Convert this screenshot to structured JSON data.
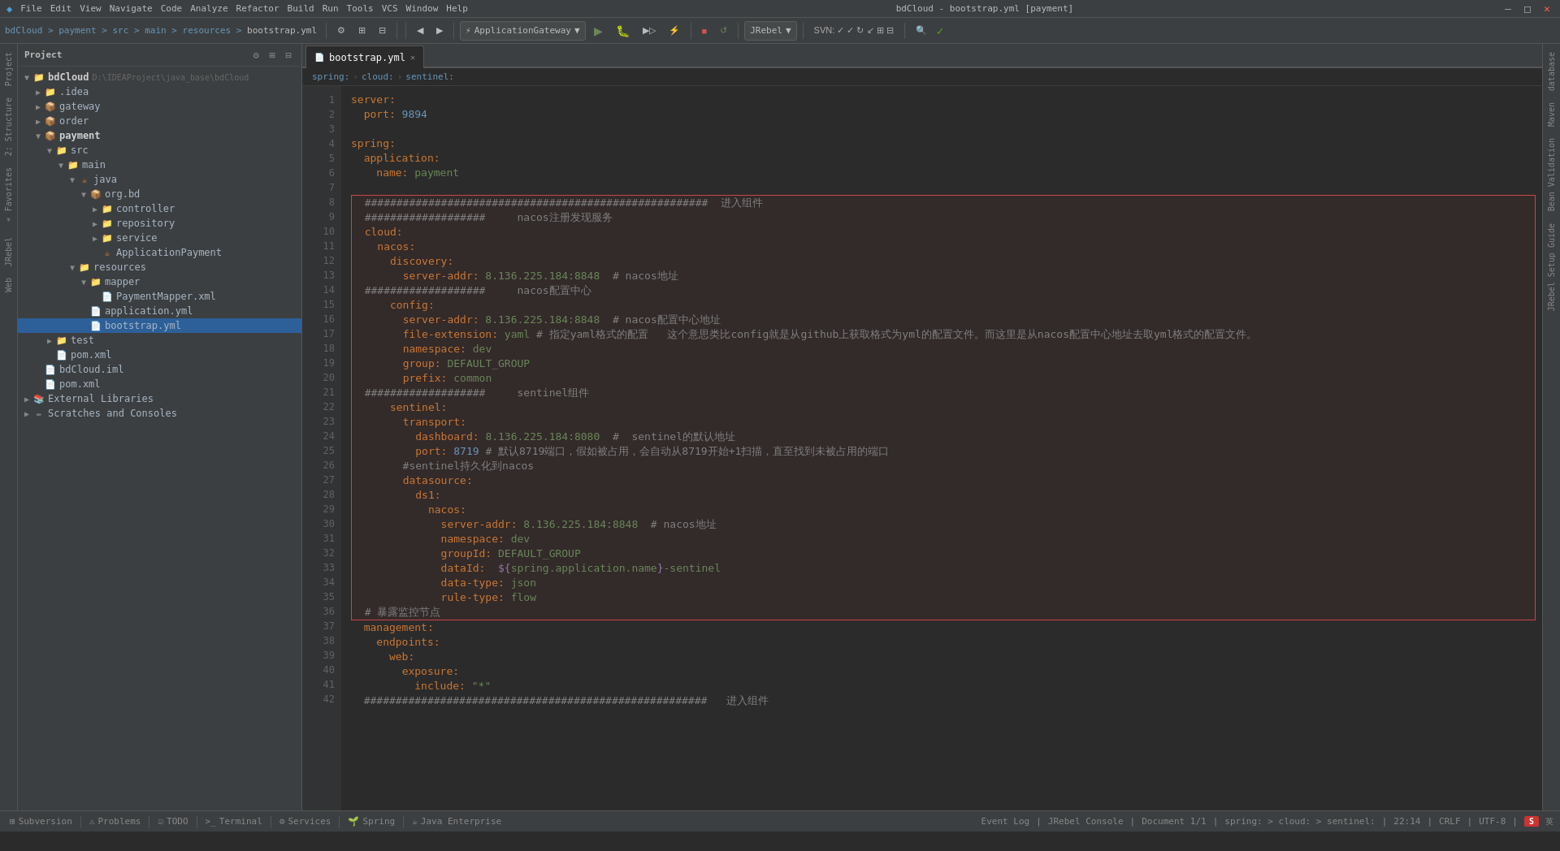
{
  "titlebar": {
    "menu_items": [
      "File",
      "Edit",
      "View",
      "Navigate",
      "Code",
      "Analyze",
      "Refactor",
      "Build",
      "Run",
      "Tools",
      "VCS",
      "Window",
      "Help"
    ],
    "title": "bdCloud - bootstrap.yml [payment]",
    "app_name": "bdCloud",
    "minimize": "–",
    "maximize": "□",
    "close": "✕"
  },
  "breadcrumbs": [
    {
      "label": "bdCloud"
    },
    {
      "label": "payment"
    },
    {
      "label": "src"
    },
    {
      "label": "main"
    },
    {
      "label": "resources"
    },
    {
      "label": "bootstrap.yml"
    }
  ],
  "tab_bar": {
    "tabs": [
      {
        "label": "bootstrap.yml",
        "active": true,
        "icon": "📄"
      }
    ]
  },
  "breadcrumb_nav": {
    "items": [
      "spring:",
      "cloud:",
      "sentinel:"
    ]
  },
  "project": {
    "title": "Project",
    "tree": [
      {
        "id": "bdcloud-root",
        "label": "bdCloud",
        "level": 0,
        "type": "root",
        "expanded": true,
        "path": "D:\\IDEAProject\\java_base\\bdCloud"
      },
      {
        "id": "idea",
        "label": ".idea",
        "level": 1,
        "type": "folder",
        "expanded": false
      },
      {
        "id": "gateway",
        "label": "gateway",
        "level": 1,
        "type": "module",
        "expanded": false
      },
      {
        "id": "order",
        "label": "order",
        "level": 1,
        "type": "module",
        "expanded": false
      },
      {
        "id": "payment",
        "label": "payment",
        "level": 1,
        "type": "module",
        "expanded": true,
        "bold": true
      },
      {
        "id": "src",
        "label": "src",
        "level": 2,
        "type": "folder",
        "expanded": true
      },
      {
        "id": "main",
        "label": "main",
        "level": 3,
        "type": "folder",
        "expanded": true
      },
      {
        "id": "java",
        "label": "java",
        "level": 4,
        "type": "folder",
        "expanded": true
      },
      {
        "id": "org.bd",
        "label": "org.bd",
        "level": 5,
        "type": "package",
        "expanded": true
      },
      {
        "id": "controller",
        "label": "controller",
        "level": 6,
        "type": "folder",
        "expanded": false
      },
      {
        "id": "repository",
        "label": "repository",
        "level": 6,
        "type": "folder",
        "expanded": false
      },
      {
        "id": "service",
        "label": "service",
        "level": 6,
        "type": "folder",
        "expanded": false
      },
      {
        "id": "ApplicationPayment",
        "label": "ApplicationPayment",
        "level": 6,
        "type": "java",
        "expanded": false
      },
      {
        "id": "resources",
        "label": "resources",
        "level": 4,
        "type": "folder",
        "expanded": true
      },
      {
        "id": "mapper",
        "label": "mapper",
        "level": 5,
        "type": "folder",
        "expanded": true
      },
      {
        "id": "PaymentMapper.xml",
        "label": "PaymentMapper.xml",
        "level": 6,
        "type": "xml"
      },
      {
        "id": "application.yml",
        "label": "application.yml",
        "level": 5,
        "type": "yml"
      },
      {
        "id": "bootstrap.yml",
        "label": "bootstrap.yml",
        "level": 5,
        "type": "yml",
        "selected": true
      },
      {
        "id": "test",
        "label": "test",
        "level": 2,
        "type": "folder",
        "expanded": false
      },
      {
        "id": "pom.xml-payment",
        "label": "pom.xml",
        "level": 2,
        "type": "xml"
      },
      {
        "id": "bdCloud.iml",
        "label": "bdCloud.iml",
        "level": 1,
        "type": "iml"
      },
      {
        "id": "pom.xml-root",
        "label": "pom.xml",
        "level": 1,
        "type": "xml"
      },
      {
        "id": "external-libs",
        "label": "External Libraries",
        "level": 0,
        "type": "libs",
        "expanded": false
      },
      {
        "id": "scratches",
        "label": "Scratches and Consoles",
        "level": 0,
        "type": "scratches",
        "expanded": false
      }
    ]
  },
  "code": {
    "lines": [
      {
        "num": 1,
        "text": "server:",
        "highlighted": false
      },
      {
        "num": 2,
        "text": "  port: 9894",
        "highlighted": false
      },
      {
        "num": 3,
        "text": "",
        "highlighted": false
      },
      {
        "num": 4,
        "text": "spring:",
        "highlighted": false
      },
      {
        "num": 5,
        "text": "  application:",
        "highlighted": false
      },
      {
        "num": 6,
        "text": "    name: payment",
        "highlighted": false
      },
      {
        "num": 7,
        "text": "",
        "highlighted": false
      },
      {
        "num": 8,
        "text": "  ######################################################   进入组件",
        "highlighted": true,
        "comment": true
      },
      {
        "num": 9,
        "text": "  ###################     nacos注册发现服务",
        "highlighted": true,
        "comment": true
      },
      {
        "num": 10,
        "text": "  cloud:",
        "highlighted": true
      },
      {
        "num": 11,
        "text": "    nacos:",
        "highlighted": true
      },
      {
        "num": 12,
        "text": "      discovery:",
        "highlighted": true
      },
      {
        "num": 13,
        "text": "        server-addr: 8.136.225.184:8848  # nacos地址",
        "highlighted": true
      },
      {
        "num": 14,
        "text": "  ###################     nacos配置中心",
        "highlighted": true,
        "comment": true
      },
      {
        "num": 15,
        "text": "      config:",
        "highlighted": true
      },
      {
        "num": 16,
        "text": "        server-addr: 8.136.225.184:8848  # nacos配置中心地址",
        "highlighted": true
      },
      {
        "num": 17,
        "text": "        file-extension: yaml # 指定yaml格式的配置    这个意思类比config就是从github上获取格式为yml的配置文件，而这里是从nacos配置中心地址去取yml格式的配置文件。",
        "highlighted": true
      },
      {
        "num": 18,
        "text": "        namespace: dev",
        "highlighted": true
      },
      {
        "num": 19,
        "text": "        group: DEFAULT_GROUP",
        "highlighted": true
      },
      {
        "num": 20,
        "text": "        prefix: common",
        "highlighted": true
      },
      {
        "num": 21,
        "text": "  ###################     sentinel组件",
        "highlighted": true,
        "comment": true
      },
      {
        "num": 22,
        "text": "      sentinel:",
        "highlighted": true
      },
      {
        "num": 23,
        "text": "        transport:",
        "highlighted": true
      },
      {
        "num": 24,
        "text": "          dashboard: 8.136.225.184:8080  #  sentinel的默认地址",
        "highlighted": true
      },
      {
        "num": 25,
        "text": "          port: 8719 # 默认8719端口，假如被占用，会自动从8719开始+1扫描，直至找到未被占用的端口",
        "highlighted": true
      },
      {
        "num": 26,
        "text": "        #sentinel持久化到nacos",
        "highlighted": true,
        "comment": true
      },
      {
        "num": 27,
        "text": "        datasource:",
        "highlighted": true
      },
      {
        "num": 28,
        "text": "          ds1:",
        "highlighted": true
      },
      {
        "num": 29,
        "text": "            nacos:",
        "highlighted": true
      },
      {
        "num": 30,
        "text": "              server-addr: 8.136.225.184:8848  # nacos地址",
        "highlighted": true
      },
      {
        "num": 31,
        "text": "              namespace: dev",
        "highlighted": true
      },
      {
        "num": 32,
        "text": "              groupId: DEFAULT_GROUP",
        "highlighted": true
      },
      {
        "num": 33,
        "text": "              dataId:  ${spring.application.name}-sentinel",
        "highlighted": true
      },
      {
        "num": 34,
        "text": "              data-type: json",
        "highlighted": true
      },
      {
        "num": 35,
        "text": "              rule-type: flow",
        "highlighted": true
      },
      {
        "num": 36,
        "text": "  # 暴露监控节点",
        "highlighted": true,
        "comment": true
      },
      {
        "num": 37,
        "text": "  management:",
        "highlighted": false
      },
      {
        "num": 38,
        "text": "    endpoints:",
        "highlighted": false
      },
      {
        "num": 39,
        "text": "      web:",
        "highlighted": false
      },
      {
        "num": 40,
        "text": "        exposure:",
        "highlighted": false
      },
      {
        "num": 41,
        "text": "          include: \"*\"",
        "highlighted": false
      },
      {
        "num": 42,
        "text": "  ######################################################   进入组件",
        "highlighted": false,
        "comment": true
      }
    ]
  },
  "status_bar": {
    "left_items": [
      "Subversion",
      "Problems",
      "TODO",
      "Terminal",
      "Services",
      "Spring",
      "Java Enterprise"
    ],
    "right_items": [
      "Document 1/1",
      "CRLF",
      "UTF-8",
      "22:14"
    ],
    "breadcrumb": "spring:  >  cloud:  >  sentinel:"
  },
  "right_panel_tabs": [
    "database",
    "Maven",
    "Bean Validation",
    "JRebel Setup Guide"
  ],
  "left_panel_tabs": [
    "Project",
    "Structure",
    "Favorites",
    "JRebel",
    "Web"
  ],
  "toolbar": {
    "run_config": "ApplicationGateway",
    "jrebel_config": "JRebel"
  }
}
